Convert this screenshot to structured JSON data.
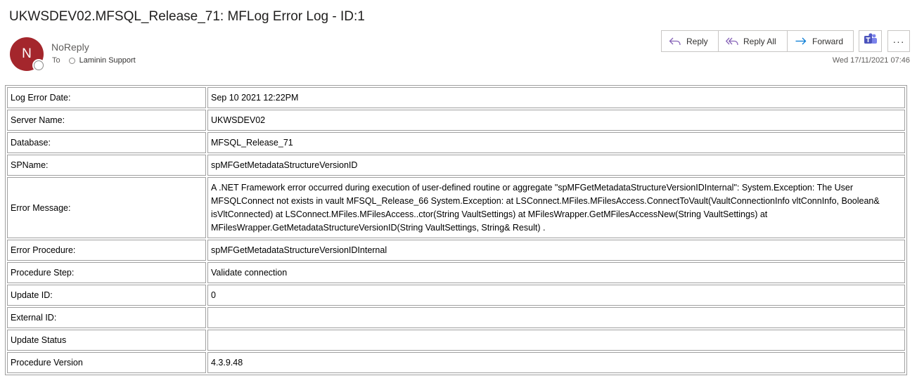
{
  "email": {
    "subject": "UKWSDEV02.MFSQL_Release_71: MFLog Error Log - ID:1",
    "avatar_initial": "N",
    "avatar_color": "#a4262c",
    "sender": "NoReply",
    "to_label": "To",
    "recipient": "Laminin Support",
    "date": "Wed 17/11/2021 07:46"
  },
  "actions": {
    "reply": "Reply",
    "reply_all": "Reply All",
    "forward": "Forward",
    "teams_icon": "teams-icon",
    "more": "···"
  },
  "rows": [
    {
      "label": "Log Error Date:",
      "value": "Sep 10 2021 12:22PM"
    },
    {
      "label": "Server Name:",
      "value": "UKWSDEV02"
    },
    {
      "label": "Database:",
      "value": "MFSQL_Release_71"
    },
    {
      "label": "SPName:",
      "value": "spMFGetMetadataStructureVersionID"
    },
    {
      "label": "Error Message:",
      "value": "A .NET Framework error occurred during execution of user-defined routine or aggregate \"spMFGetMetadataStructureVersionIDInternal\": System.Exception: The User MFSQLConnect not exists in vault MFSQL_Release_66 System.Exception: at LSConnect.MFiles.MFilesAccess.ConnectToVault(VaultConnectionInfo vltConnInfo, Boolean& isVltConnected) at LSConnect.MFiles.MFilesAccess..ctor(String VaultSettings) at MFilesWrapper.GetMFilesAccessNew(String VaultSettings) at MFilesWrapper.GetMetadataStructureVersionID(String VaultSettings, String& Result) ."
    },
    {
      "label": "Error Procedure:",
      "value": "spMFGetMetadataStructureVersionIDInternal"
    },
    {
      "label": "Procedure Step:",
      "value": "Validate connection"
    },
    {
      "label": "Update ID:",
      "value": "0"
    },
    {
      "label": "External ID:",
      "value": ""
    },
    {
      "label": "Update Status",
      "value": ""
    },
    {
      "label": "Procedure Version",
      "value": "4.3.9.48"
    }
  ]
}
